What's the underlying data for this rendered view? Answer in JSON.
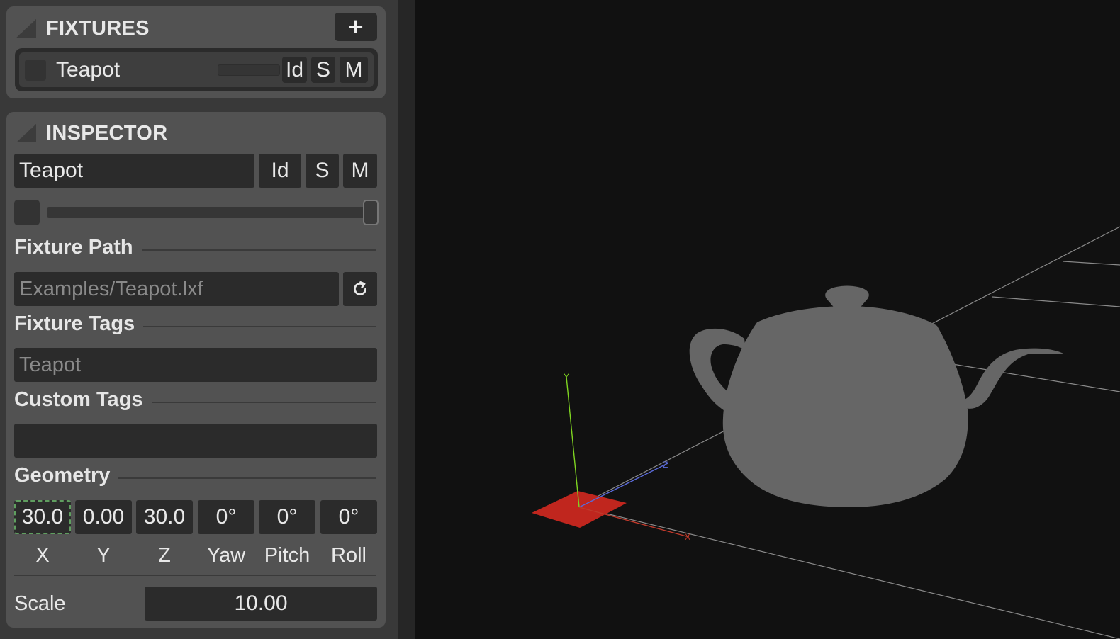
{
  "fixtures_panel": {
    "title": "FIXTURES",
    "add_label": "+",
    "items": [
      {
        "name": "Teapot",
        "toggles": [
          "Id",
          "S",
          "M"
        ]
      }
    ]
  },
  "inspector": {
    "title": "INSPECTOR",
    "name_value": "Teapot",
    "toggles": [
      "Id",
      "S",
      "M"
    ],
    "brightness": 1.0,
    "fixture_path": {
      "label": "Fixture Path",
      "placeholder": "Examples/Teapot.lxf",
      "refresh_icon": "refresh-icon"
    },
    "fixture_tags": {
      "label": "Fixture Tags",
      "placeholder": "Teapot"
    },
    "custom_tags": {
      "label": "Custom Tags",
      "value": ""
    },
    "geometry": {
      "label": "Geometry",
      "fields": [
        {
          "label": "X",
          "value": "30.0"
        },
        {
          "label": "Y",
          "value": "0.00"
        },
        {
          "label": "Z",
          "value": "30.0"
        },
        {
          "label": "Yaw",
          "value": "0°"
        },
        {
          "label": "Pitch",
          "value": "0°"
        },
        {
          "label": "Roll",
          "value": "0°"
        }
      ]
    },
    "scale": {
      "label": "Scale",
      "value": "10.00"
    }
  },
  "viewport": {
    "axis_labels": {
      "x": "X",
      "y": "Y",
      "z": "Z"
    },
    "colors": {
      "background": "#111111",
      "model": "#666666",
      "x_axis": "#c0392b",
      "y_axis": "#7ed321",
      "z_axis": "#5a6ad8",
      "origin_marker": "#c0261e",
      "grid": "#8a8a8a"
    }
  }
}
